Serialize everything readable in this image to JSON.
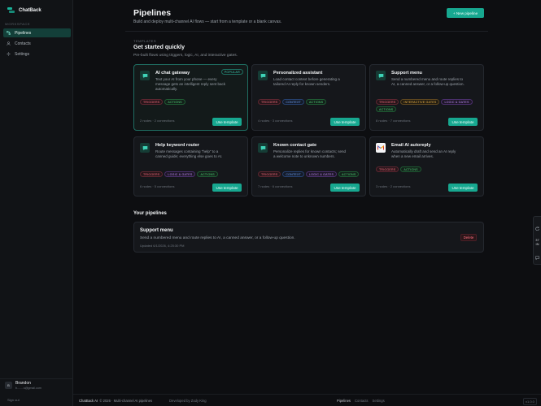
{
  "app": {
    "name": "ChatBack"
  },
  "sidebar": {
    "workspace_label": "WORKSPACE",
    "items": [
      {
        "label": "Pipelines",
        "icon": "pipelines-icon",
        "active": true
      },
      {
        "label": "Contacts",
        "icon": "user-icon",
        "active": false
      },
      {
        "label": "Settings",
        "icon": "settings-icon",
        "active": false
      }
    ],
    "user": {
      "initial": "B",
      "name": "Brandon",
      "email": "b........s@gmail.com"
    },
    "signout": "Sign out"
  },
  "header": {
    "title": "Pipelines",
    "subtitle": "Build and deploy multi-channel AI flows — start from a template or a blank canvas.",
    "new_button": "+ New pipeline"
  },
  "templates": {
    "eyebrow": "TEMPLATES",
    "title": "Get started quickly",
    "subtitle": "Pre-built flows using triggers, logic, AI, and interactive gates.",
    "use_label": "Use template",
    "cards": [
      {
        "title": "AI chat gateway",
        "desc": "Text your AI from your phone — every message gets an intelligent reply sent back automatically.",
        "badge": "POPULAR",
        "tags": [
          "TRIGGERS",
          "ACTIONS"
        ],
        "meta": "2 nodes · 2 connections",
        "icon": "chat-icon"
      },
      {
        "title": "Personalized assistant",
        "desc": "Load contact context before generating a tailored AI reply for known senders.",
        "tags": [
          "TRIGGERS",
          "CONTEXT",
          "ACTIONS"
        ],
        "meta": "4 nodes · 3 connections",
        "icon": "chat-icon"
      },
      {
        "title": "Support menu",
        "desc": "Send a numbered menu and route replies to AI, a canned answer, or a follow-up question.",
        "tags": [
          "TRIGGERS",
          "INTERACTIVE GATES",
          "LOGIC & GATES",
          "ACTIONS"
        ],
        "meta": "8 nodes · 7 connections",
        "icon": "chat-icon"
      },
      {
        "title": "Help keyword router",
        "desc": "Route messages containing \"help\" to a canned guide; everything else goes to AI.",
        "tags": [
          "TRIGGERS",
          "LOGIC & GATES",
          "ACTIONS"
        ],
        "meta": "6 nodes · 5 connections",
        "icon": "chat-icon"
      },
      {
        "title": "Known contact gate",
        "desc": "Personalize replies for known contacts; send a welcome note to unknown numbers.",
        "tags": [
          "TRIGGERS",
          "CONTEXT",
          "LOGIC & GATES",
          "ACTIONS"
        ],
        "meta": "7 nodes · 6 connections",
        "icon": "chat-icon"
      },
      {
        "title": "Email AI autoreply",
        "desc": "Automatically draft and send an AI reply when a new email arrives.",
        "tags": [
          "TRIGGERS",
          "ACTIONS"
        ],
        "meta": "3 nodes · 2 connections",
        "icon": "gmail-icon"
      }
    ]
  },
  "your_pipelines": {
    "title": "Your pipelines",
    "items": [
      {
        "title": "Support menu",
        "desc": "Send a numbered menu and route replies to AI, a canned answer, or a follow-up question.",
        "updated": "Updated 6/1/2026, 4:25:30 PM",
        "delete_label": "Delete"
      }
    ]
  },
  "footer": {
    "brand": "ChatBack AI",
    "copy": "© 2026 · Multi-channel AI pipelines",
    "dev": "Developed by Zody King",
    "links": [
      "Pipelines",
      "Contacts",
      "Settings"
    ],
    "version": "v1.0.0"
  },
  "mini_widget": {
    "value_top": "37",
    "value_bottom": "IN"
  },
  "colors": {
    "accent": "#17a890",
    "bg": "#0d0e11",
    "card": "#15171b"
  }
}
